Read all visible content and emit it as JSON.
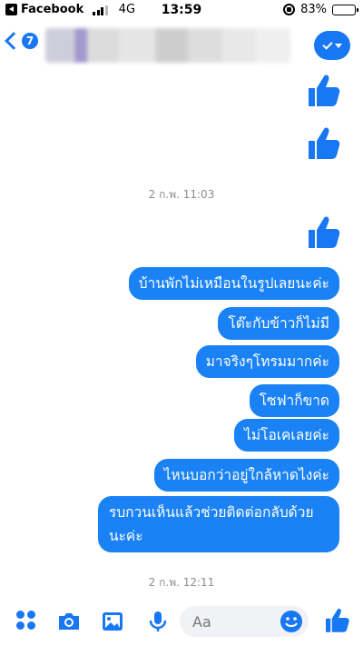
{
  "status_bar": {
    "app_back_label": "Facebook",
    "network": "4G",
    "time": "13:59",
    "battery": "83%",
    "battery_level": 0.83
  },
  "header": {
    "unread_count": "7",
    "contact_name_blurred": true
  },
  "timestamps": [
    "2 ก.พ. 11:03",
    "2 ก.พ. 12:11"
  ],
  "messages": [
    "บ้านพักไม่เหมือนในรูปเลยนะค่ะ",
    "โต๊ะกับข้าวก็ไม่มี",
    "มาจริงๆโทรมมากค่ะ",
    "โซฟาก็ขาด",
    "ไม่โอเคเลยค่ะ",
    "ไหนบอกว่าอยู่ใกล้หาดไงค่ะ",
    "รบกวนเห็นแล้วช่วยติดต่อกลับด้วยนะค่ะ"
  ],
  "composer": {
    "placeholder": "Aa"
  },
  "colors": {
    "accent": "#1877f2",
    "bubble": "#1a82f5",
    "timestamp": "#8a8d91"
  },
  "icons": [
    "back-app-icon",
    "signal-icon",
    "rotation-lock-icon",
    "battery-icon",
    "back-chevron-icon",
    "checkmark-icon",
    "dropdown-caret-icon",
    "thumbs-up-icon",
    "grid-menu-icon",
    "camera-icon",
    "photo-icon",
    "mic-icon",
    "emoji-icon"
  ]
}
